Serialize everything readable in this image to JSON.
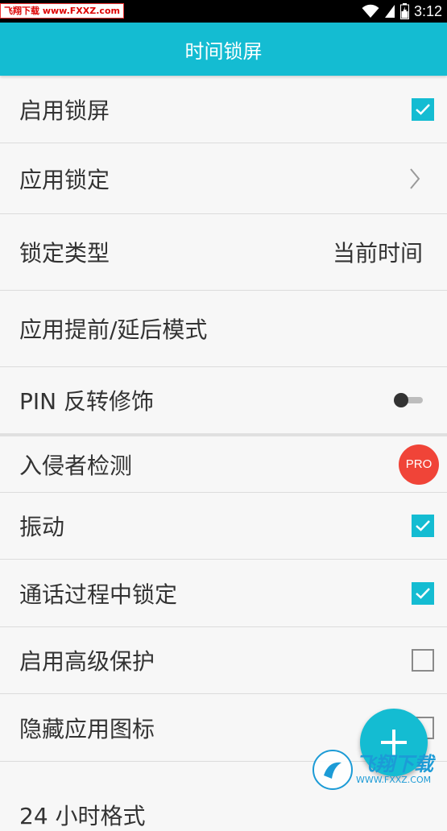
{
  "status_bar": {
    "time": "3:12",
    "watermark": "飞翔下载 www.FXXZ.com",
    "icons": [
      "wifi-icon",
      "signal-icon",
      "battery-icon"
    ]
  },
  "app_bar": {
    "title": "时间锁屏"
  },
  "colors": {
    "accent": "#14bcd2",
    "pro": "#f04438"
  },
  "settings": [
    {
      "label": "启用锁屏",
      "control": "checkbox",
      "checked": true
    },
    {
      "label": "应用锁定",
      "control": "chevron"
    },
    {
      "label": "锁定类型",
      "control": "value",
      "value": "当前时间"
    },
    {
      "label": "应用提前/延后模式",
      "control": "none"
    },
    {
      "label": "PIN 反转修饰",
      "control": "switch",
      "on": false
    },
    {
      "label": "入侵者检测",
      "control": "pro",
      "badge": "PRO"
    },
    {
      "label": "振动",
      "control": "checkbox",
      "checked": true
    },
    {
      "label": "通话过程中锁定",
      "control": "checkbox",
      "checked": true
    },
    {
      "label": "启用高级保护",
      "control": "checkbox",
      "checked": false
    },
    {
      "label": "隐藏应用图标",
      "control": "checkbox",
      "checked": false
    },
    {
      "label": "24 小时格式",
      "control": "checkbox",
      "checked": false
    }
  ],
  "fab": {
    "icon": "plus-icon"
  },
  "watermark_bottom": {
    "big": "飞翔下载",
    "small": "WWW.FXXZ.COM"
  }
}
